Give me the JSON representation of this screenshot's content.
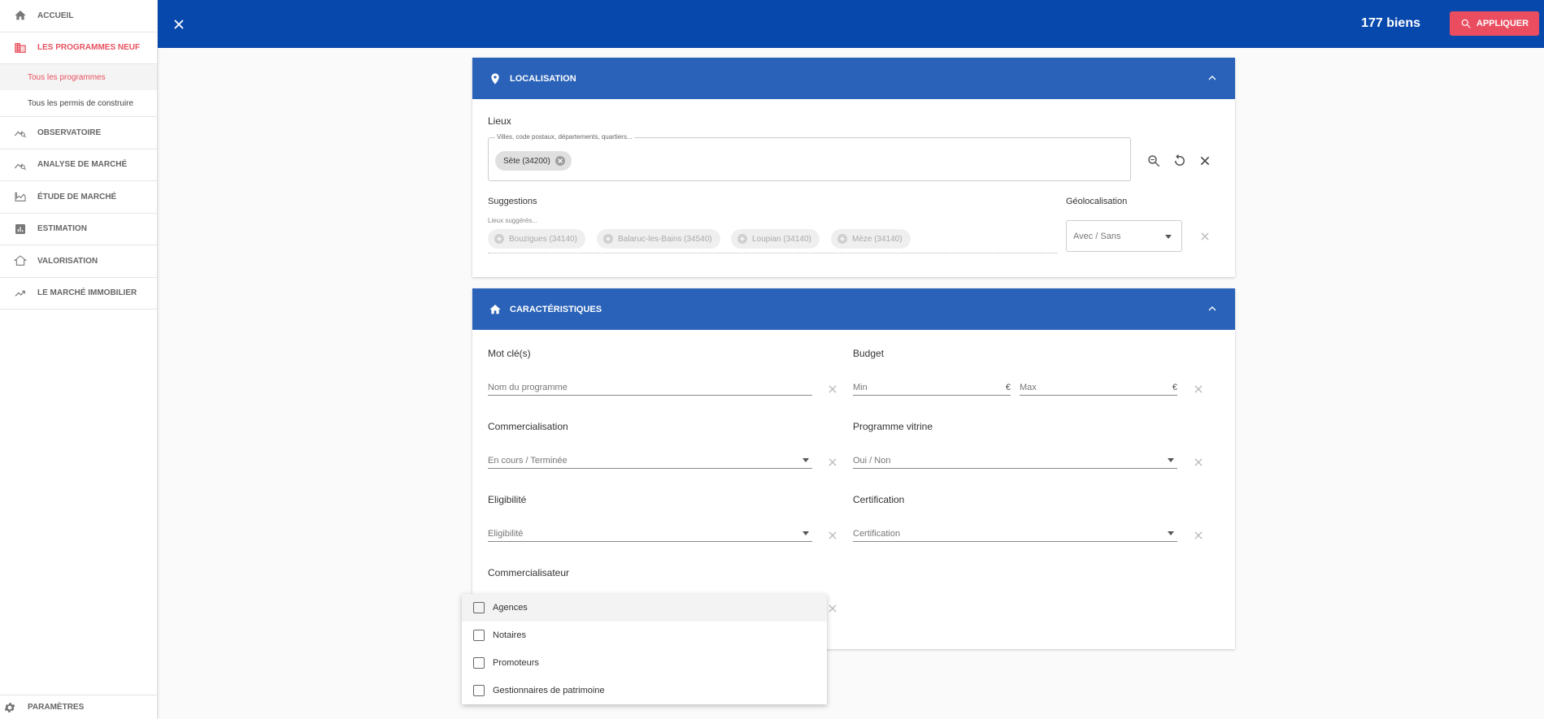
{
  "sidebar": {
    "items": [
      {
        "label": "ACCUEIL",
        "icon": "home-icon"
      },
      {
        "label": "LES PROGRAMMES NEUF",
        "icon": "building-icon"
      },
      {
        "label": "OBSERVATOIRE",
        "icon": "chart-search-icon"
      },
      {
        "label": "ANALYSE DE MARCHÉ",
        "icon": "chart-search-icon"
      },
      {
        "label": "ÉTUDE DE MARCHÉ",
        "icon": "area-chart-icon"
      },
      {
        "label": "ESTIMATION",
        "icon": "bar-chart-icon"
      },
      {
        "label": "VALORISATION",
        "icon": "house-outline-icon"
      },
      {
        "label": "LE MARCHÉ IMMOBILIER",
        "icon": "trending-up-icon"
      }
    ],
    "sub_items": [
      "Tous les programmes",
      "Tous les permis de construire"
    ],
    "settings_label": "PARAMÈTRES"
  },
  "topbar": {
    "count": "177 biens",
    "apply_label": "APPLIQUER"
  },
  "localisation": {
    "title": "LOCALISATION",
    "lieux_label": "Lieux",
    "lieux_hint": "Villes, code postaux, départements, quartiers...",
    "selected_chip": "Sète (34200)",
    "suggestions_label": "Suggestions",
    "suggestions_hint": "Lieux suggérés...",
    "suggestions": [
      "Bouzigues (34140)",
      "Balaruc-les-Bains (34540)",
      "Loupian (34140)",
      "Mèze (34140)"
    ],
    "geoloc_label": "Géolocalisation",
    "geoloc_value": "Avec / Sans"
  },
  "caracteristiques": {
    "title": "CARACTÉRISTIQUES",
    "mot_cle_label": "Mot clé(s)",
    "mot_cle_placeholder": "Nom du programme",
    "budget_label": "Budget",
    "budget_min": "Min",
    "budget_max": "Max",
    "currency": "€",
    "commercialisation_label": "Commercialisation",
    "commercialisation_value": "En cours / Terminée",
    "vitrine_label": "Programme vitrine",
    "vitrine_value": "Oui / Non",
    "eligibilite_label": "Eligibilité",
    "eligibilite_value": "Eligibilité",
    "certification_label": "Certification",
    "certification_value": "Certification",
    "commercialisateur_label": "Commercialisateur"
  },
  "dropdown": {
    "options": [
      "Agences",
      "Notaires",
      "Promoteurs",
      "Gestionnaires de patrimoine"
    ]
  },
  "colors": {
    "topbar": "#0748ac",
    "card_header": "#2962b8",
    "accent": "#eb4d60"
  }
}
